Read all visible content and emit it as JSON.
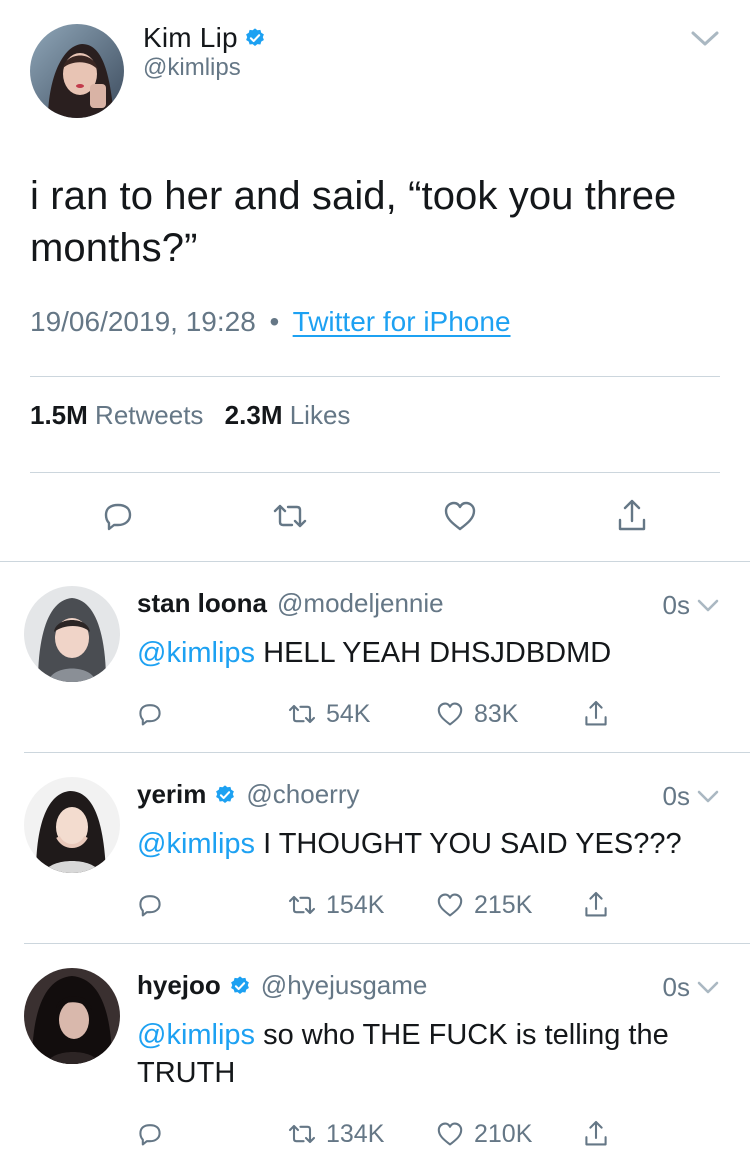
{
  "main_tweet": {
    "name": "Kim Lip",
    "handle": "@kimlips",
    "text": "i ran to her and said, “took you three months?”",
    "timestamp": "19/06/2019, 19:28",
    "separator": "•",
    "source": "Twitter for iPhone",
    "retweets_count": "1.5M",
    "retweets_label": "Retweets",
    "likes_count": "2.3M",
    "likes_label": "Likes",
    "verified": true
  },
  "replies": [
    {
      "name": "stan loona",
      "handle": "@modeljennie",
      "verified": false,
      "time": "0s",
      "mention": "@kimlips",
      "text": "HELL YEAH DHSJDBDMD",
      "retweets": "54K",
      "likes": "83K"
    },
    {
      "name": "yerim",
      "handle": "@choerry",
      "verified": true,
      "time": "0s",
      "mention": "@kimlips",
      "text": "I THOUGHT YOU SAID YES???",
      "retweets": "154K",
      "likes": "215K"
    },
    {
      "name": "hyejoo",
      "handle": "@hyejusgame",
      "verified": true,
      "time": "0s",
      "mention": "@kimlips",
      "text": "so who THE FUCK is telling the TRUTH",
      "retweets": "134K",
      "likes": "210K"
    }
  ],
  "icons": {
    "reply": "reply-icon",
    "retweet": "retweet-icon",
    "like": "heart-icon",
    "share": "share-icon",
    "verified": "verified-badge-icon",
    "menu": "chevron-down-icon"
  },
  "colors": {
    "accent": "#1da1f2",
    "text": "#14171a",
    "secondary": "#657786",
    "divider": "#ccd6dd"
  }
}
